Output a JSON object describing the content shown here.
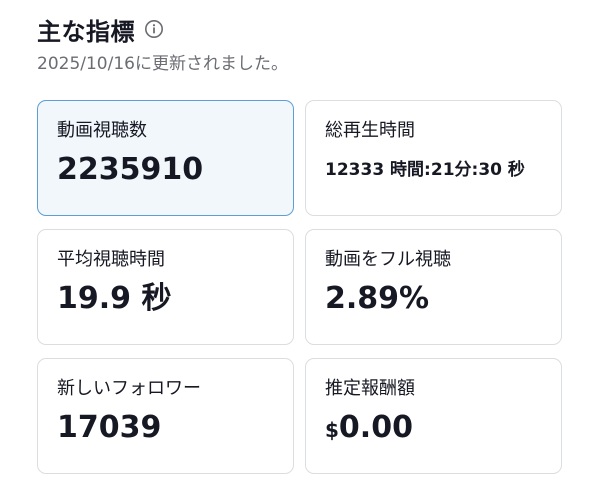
{
  "header": {
    "title": "主な指標",
    "updated_text": "2025/10/16に更新されました。"
  },
  "metrics": [
    {
      "label": "動画視聴数",
      "value": "2235910"
    },
    {
      "label": "総再生時間",
      "value": "12333 時間:21分:30 秒"
    },
    {
      "label": "平均視聴時間",
      "value": "19.9 秒"
    },
    {
      "label": "動画をフル視聴",
      "value": "2.89%"
    },
    {
      "label": "新しいフォロワー",
      "value": "17039"
    },
    {
      "label": "推定報酬額",
      "currency": "$",
      "value": "0.00"
    }
  ],
  "icons": {
    "info": "info-icon"
  },
  "colors": {
    "selected_border": "#5e9ed4",
    "selected_background": "#f2f7fc",
    "card_border": "#dcdde0",
    "text": "#161823",
    "muted_text": "#6b6d73"
  }
}
